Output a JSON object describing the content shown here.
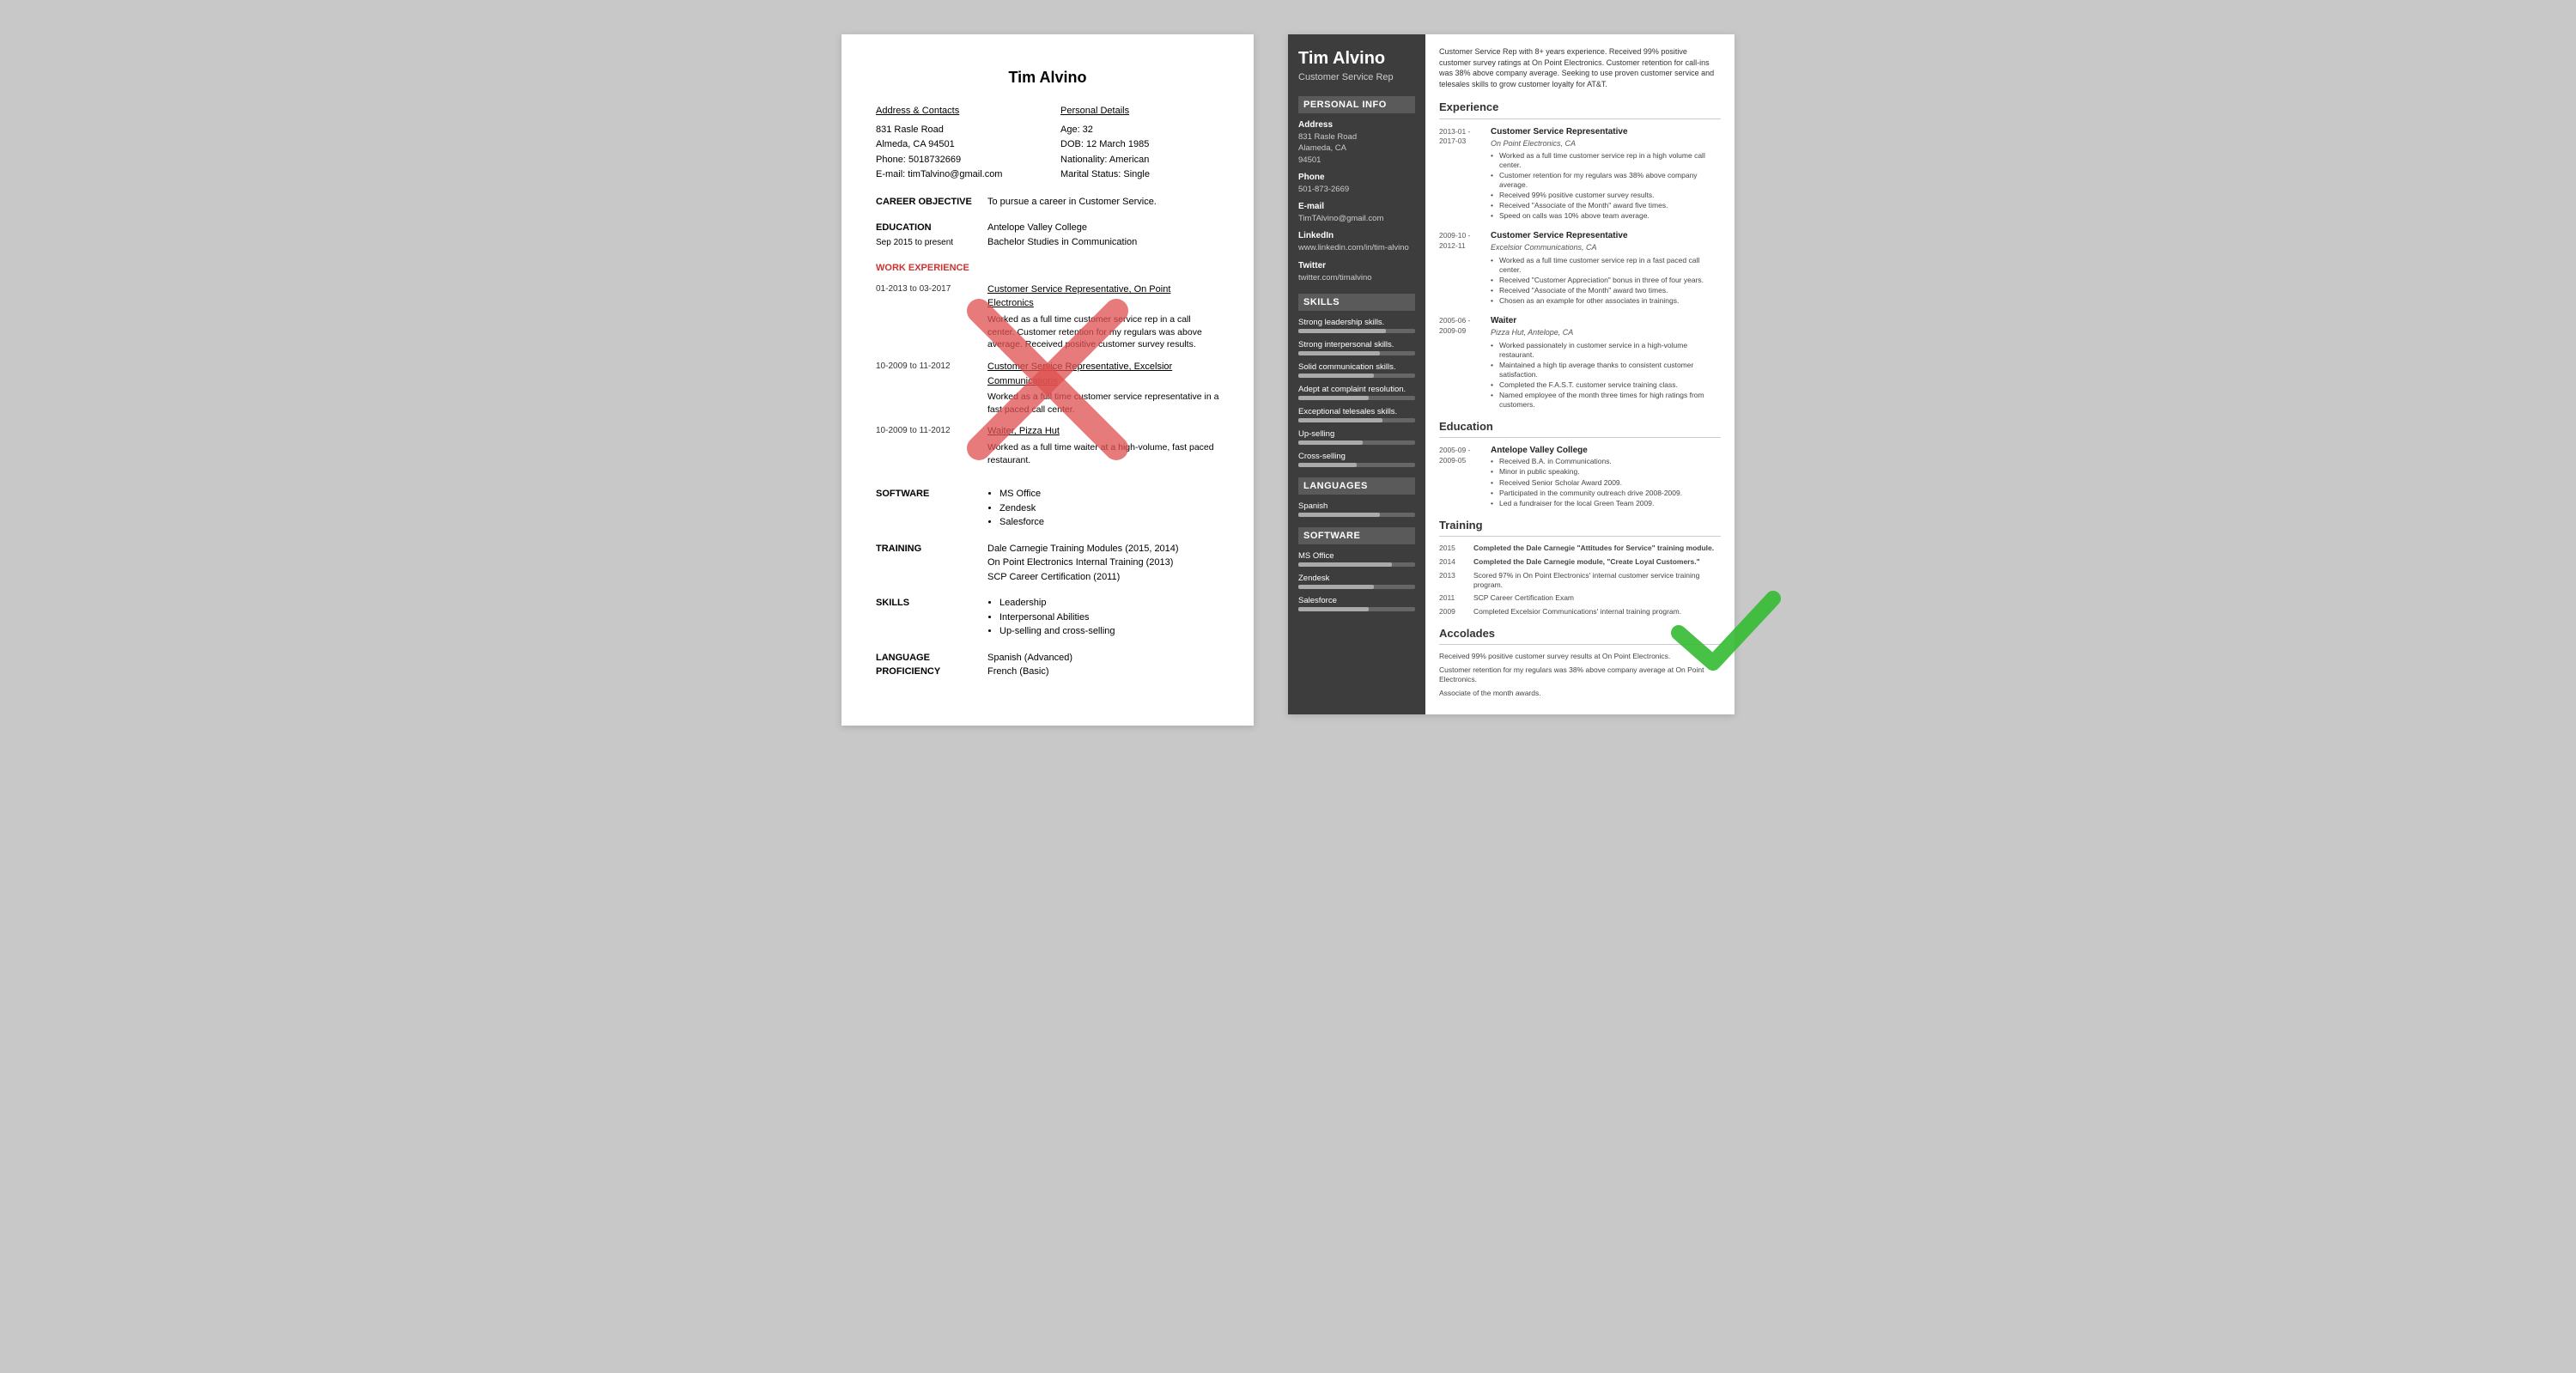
{
  "left_resume": {
    "name": "Tim Alvino",
    "contacts_left_header": "Address & Contacts",
    "address_line1": "831 Rasle Road",
    "address_line2": "Almeda, CA 94501",
    "phone": "Phone: 5018732669",
    "email": "E-mail: timTalvino@gmail.com",
    "contacts_right_header": "Personal Details",
    "age": "Age:   32",
    "dob": "DOB:  12 March 1985",
    "nationality": "Nationality: American",
    "marital": "Marital Status: Single",
    "career_objective_label": "CAREER OBJECTIVE",
    "career_objective_text": "To pursue a career in Customer Service.",
    "education_label": "EDUCATION",
    "education_dates": "Sep 2015 to present",
    "education_school": "Antelope Valley College",
    "education_degree": "Bachelor Studies in Communication",
    "work_experience_label": "WORK EXPERIENCE",
    "work_entries": [
      {
        "dates": "01-2013 to 03-2017",
        "title_link": "Customer Service Representative, On Point Electronics",
        "description": "Worked as a full time customer service rep in a call center. Customer retention for my regulars was above average. Received positive customer survey results."
      },
      {
        "dates": "10-2009 to 11-2012",
        "title_link": "Customer Service Representative, Excelsior Communications",
        "description": "Worked as a full time customer service representative in a fast paced call center."
      },
      {
        "dates": "10-2009 to 11-2012",
        "title_link": "Waiter, Pizza Hut",
        "description": "Worked as a full time waiter at a high-volume, fast paced restaurant."
      }
    ],
    "software_label": "SOFTWARE",
    "software_items": [
      "MS Office",
      "Zendesk",
      "Salesforce"
    ],
    "training_label": "TRAINING",
    "training_text": "Dale Carnegie Training Modules (2015, 2014)\nOn Point Electronics Internal Training (2013)\nSCP Career Certification (2011)",
    "skills_label": "SKILLS",
    "skills_items": [
      "Leadership",
      "Interpersonal Abilities",
      "Up-selling and cross-selling"
    ],
    "language_label": "LANGUAGE PROFICIENCY",
    "language_text": "Spanish (Advanced)\nFrench (Basic)"
  },
  "right_resume": {
    "name": "Tim Alvino",
    "title": "Customer Service Rep",
    "summary": "Customer Service Rep with 8+ years experience. Received 99% positive customer survey ratings at On Point Electronics. Customer retention for call-ins was 38% above company average. Seeking to use proven customer service and telesales skills to grow customer loyalty for AT&T.",
    "sidebar": {
      "personal_info_header": "Personal Info",
      "address_label": "Address",
      "address_value": "831 Rasle Road\nAlameda, CA\n94501",
      "phone_label": "Phone",
      "phone_value": "501-873-2669",
      "email_label": "E-mail",
      "email_value": "TimTAlvino@gmail.com",
      "linkedin_label": "LinkedIn",
      "linkedin_value": "www.linkedin.com/in/tim-alvino",
      "twitter_label": "Twitter",
      "twitter_value": "twitter.com/timalvino",
      "skills_header": "Skills",
      "skills": [
        {
          "label": "Strong leadership skills.",
          "pct": 75
        },
        {
          "label": "Strong interpersonal skills.",
          "pct": 70
        },
        {
          "label": "Solid communication skills.",
          "pct": 65
        },
        {
          "label": "Adept at complaint resolution.",
          "pct": 60
        },
        {
          "label": "Exceptional telesales skills.",
          "pct": 72
        },
        {
          "label": "Up-selling",
          "pct": 55
        },
        {
          "label": "Cross-selling",
          "pct": 50
        }
      ],
      "languages_header": "Languages",
      "languages": [
        {
          "label": "Spanish",
          "pct": 70
        }
      ],
      "software_header": "Software",
      "software": [
        {
          "label": "MS Office",
          "pct": 80
        },
        {
          "label": "Zendesk",
          "pct": 65
        },
        {
          "label": "Salesforce",
          "pct": 60
        }
      ]
    },
    "experience_header": "Experience",
    "experiences": [
      {
        "date_start": "2013-01 -",
        "date_end": "2017-03",
        "title": "Customer Service Representative",
        "company": "On Point Electronics, CA",
        "bullets": [
          "Worked as a full time customer service rep in a high volume call center.",
          "Customer retention for my regulars was 38% above company average.",
          "Received 99% positive customer survey results.",
          "Received \"Associate of the Month\" award five times.",
          "Speed on calls was 10% above team average."
        ]
      },
      {
        "date_start": "2009-10 -",
        "date_end": "2012-11",
        "title": "Customer Service Representative",
        "company": "Excelsior Communications, CA",
        "bullets": [
          "Worked as a full time customer service rep in a fast paced call center.",
          "Received \"Customer Appreciation\" bonus in three of four years.",
          "Received \"Associate of the Month\" award two times.",
          "Chosen as an example for other associates in trainings."
        ]
      },
      {
        "date_start": "2005-06 -",
        "date_end": "2009-09",
        "title": "Waiter",
        "company": "Pizza Hut, Antelope, CA",
        "bullets": [
          "Worked passionately in customer service in a high-volume restaurant.",
          "Maintained a high tip average thanks to consistent customer satisfaction.",
          "Completed the F.A.S.T. customer service training class.",
          "Named employee of the month three times for high ratings from customers."
        ]
      }
    ],
    "education_header": "Education",
    "education_entries": [
      {
        "date_start": "2005-09 -",
        "date_end": "2009-05",
        "school": "Antelope Valley College",
        "bullets": [
          "Received B.A. in Communications.",
          "Minor in public speaking.",
          "Received Senior Scholar Award 2009.",
          "Participated in the community outreach drive 2008-2009.",
          "Led a fundraiser for the local Green Team 2009."
        ]
      }
    ],
    "training_header": "Training",
    "training_entries": [
      {
        "year": "2015",
        "text": "Completed the Dale Carnegie \"Attitudes for Service\" training module.",
        "bold": true
      },
      {
        "year": "2014",
        "text": "Completed the Dale Carnegie module, \"Create Loyal Customers.\"",
        "bold": true
      },
      {
        "year": "2013",
        "text": "Scored 97% in On Point Electronics' internal customer service training program.",
        "bold": false
      },
      {
        "year": "2011",
        "text": "SCP Career Certification Exam",
        "bold": false
      },
      {
        "year": "2009",
        "text": "Completed Excelsior Communications' internal training program.",
        "bold": false
      }
    ],
    "accolades_header": "Accolades",
    "accolades": [
      "Received 99% positive customer survey results at On Point Electronics.",
      "Customer retention for my regulars was 38% above company average at On Point Electronics.",
      "Associate of the month awards."
    ]
  }
}
